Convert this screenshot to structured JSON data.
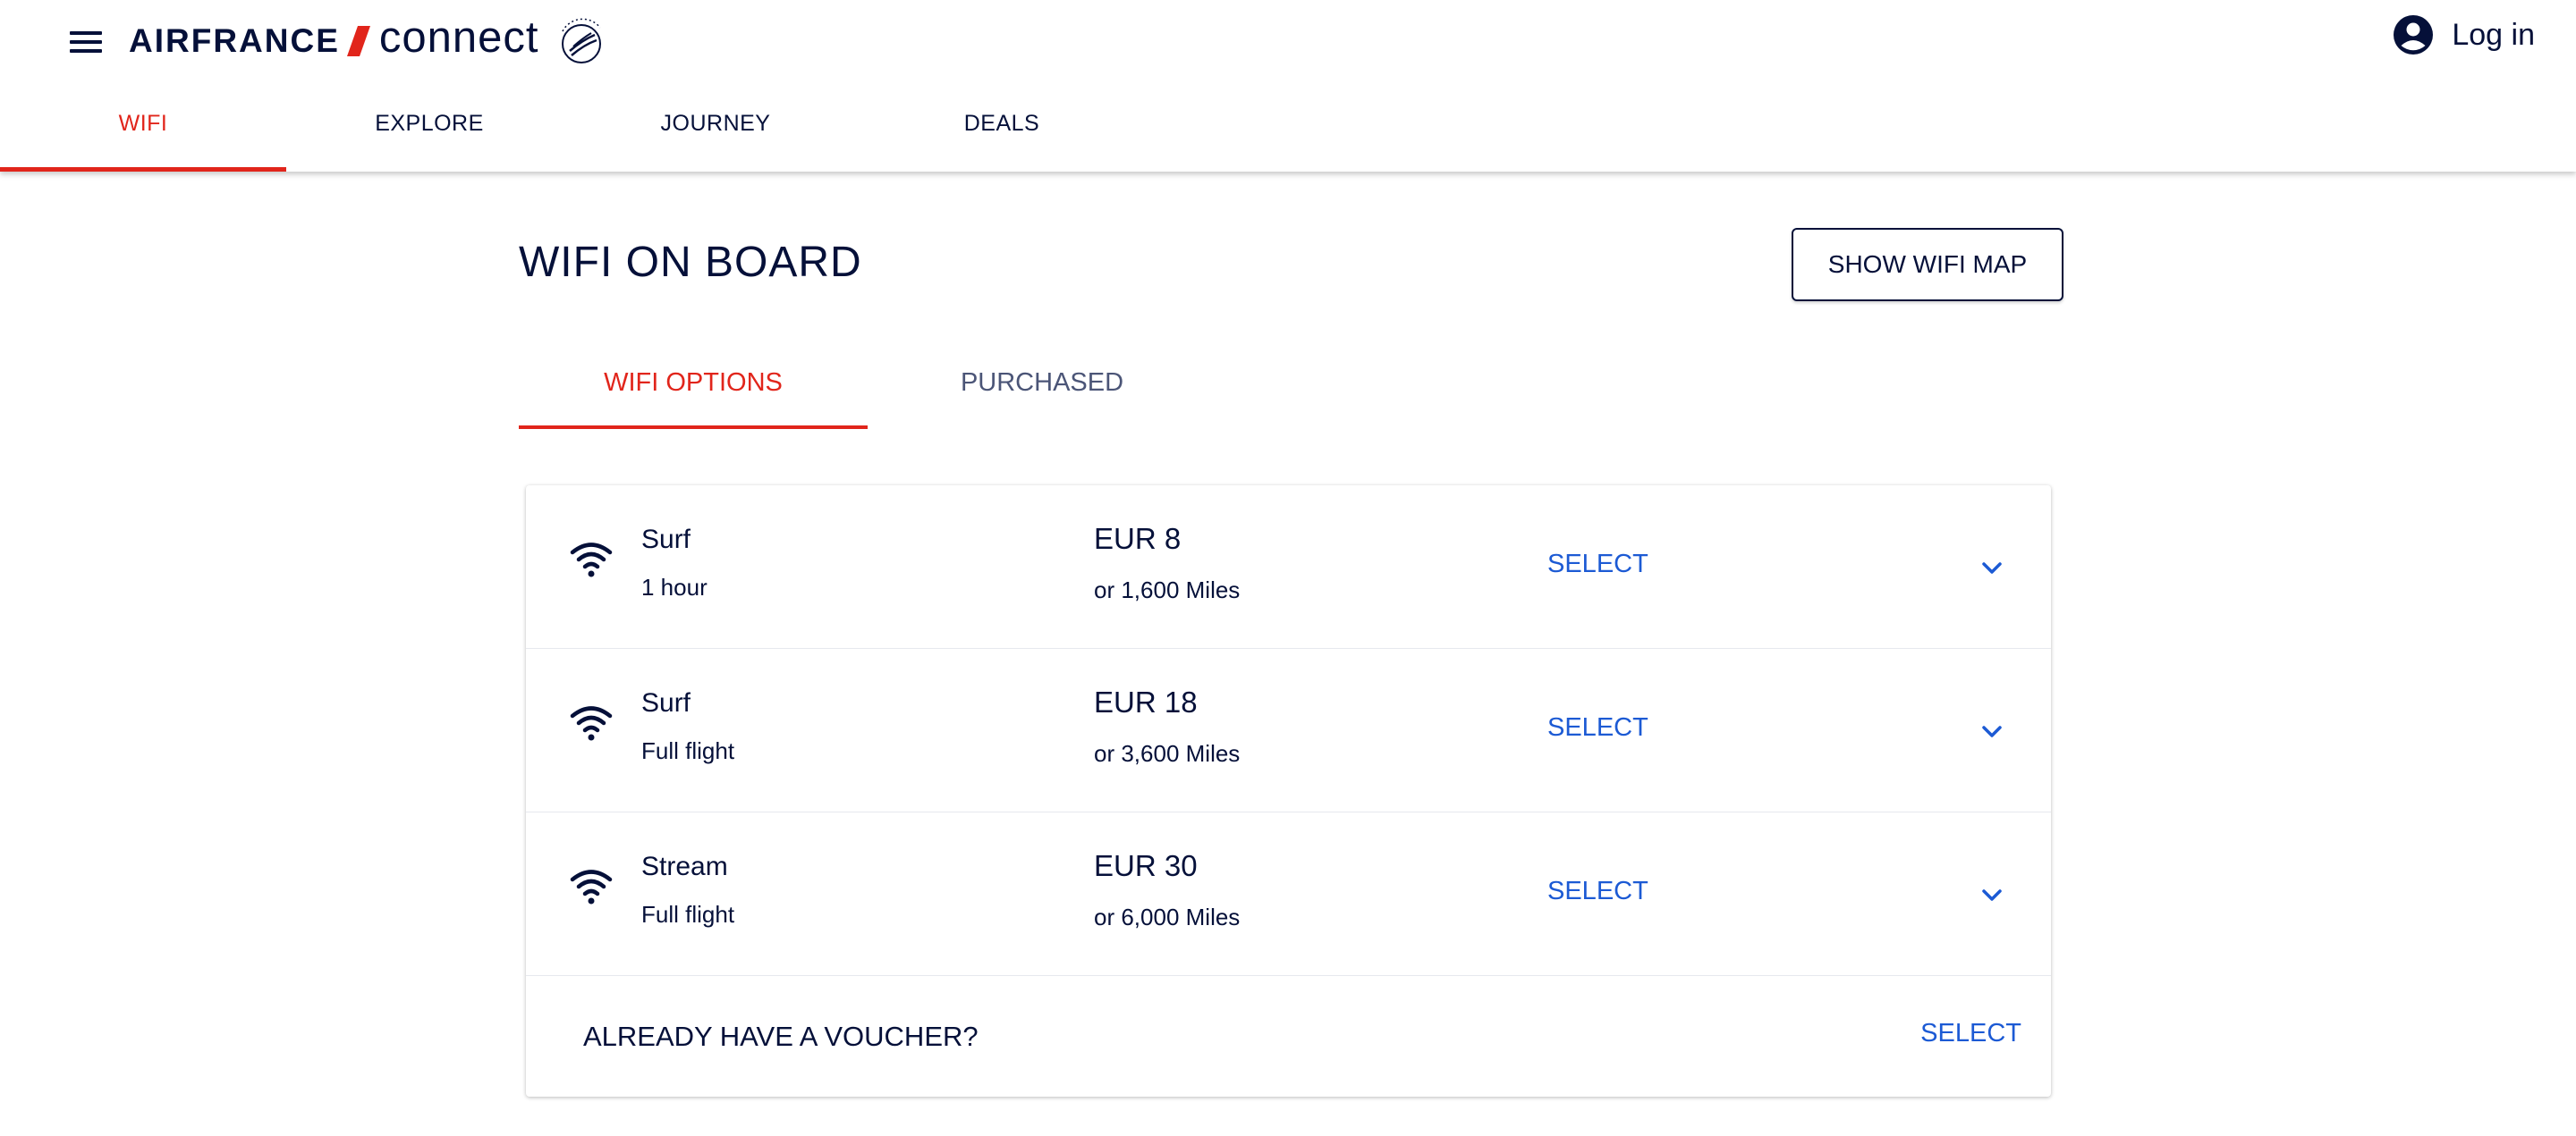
{
  "header": {
    "brand": "AIRFRANCE",
    "product": "connect",
    "login_label": "Log in",
    "colors": {
      "navy": "#051039",
      "red": "#e1251b",
      "link_blue": "#1c5ad4"
    }
  },
  "nav": {
    "items": [
      {
        "label": "WIFI",
        "active": true
      },
      {
        "label": "EXPLORE",
        "active": false
      },
      {
        "label": "JOURNEY",
        "active": false
      },
      {
        "label": "DEALS",
        "active": false
      }
    ]
  },
  "main": {
    "title": "WIFI ON BOARD",
    "map_button_label": "SHOW WIFI MAP",
    "tabs": [
      {
        "label": "WIFI OPTIONS",
        "active": true
      },
      {
        "label": "PURCHASED",
        "active": false
      }
    ],
    "options": [
      {
        "name": "Surf",
        "duration": "1 hour",
        "price": "EUR 8",
        "miles": "or 1,600 Miles",
        "select_label": "SELECT",
        "icon": "wifi-icon"
      },
      {
        "name": "Surf",
        "duration": "Full flight",
        "price": "EUR 18",
        "miles": "or 3,600 Miles",
        "select_label": "SELECT",
        "icon": "wifi-icon"
      },
      {
        "name": "Stream",
        "duration": "Full flight",
        "price": "EUR 30",
        "miles": "or 6,000 Miles",
        "select_label": "SELECT",
        "icon": "wifi-icon"
      }
    ],
    "voucher": {
      "label": "ALREADY HAVE A VOUCHER?",
      "select_label": "SELECT"
    }
  }
}
